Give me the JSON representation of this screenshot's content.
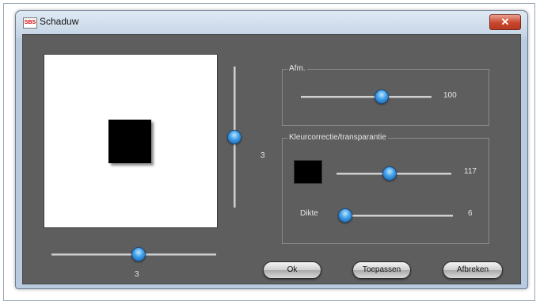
{
  "window": {
    "title": "Schaduw",
    "app_icon_text": "SBS",
    "close_glyph": "✕"
  },
  "preview": {
    "horizontal_offset": {
      "value": 3,
      "fraction": 0.53
    },
    "vertical_offset": {
      "value": 3,
      "fraction": 0.5
    }
  },
  "group_afm": {
    "title": "Afm.",
    "slider": {
      "value": 100,
      "fraction": 0.62
    }
  },
  "group_color": {
    "title": "Kleurcorrectie/transparantie",
    "swatch_color": "#000000",
    "opacity_slider": {
      "value": 117,
      "fraction": 0.46
    },
    "thickness_label": "Dikte",
    "thickness_slider": {
      "value": 6,
      "fraction": 0.06
    }
  },
  "buttons": {
    "ok": "Ok",
    "apply": "Toepassen",
    "cancel": "Afbreken"
  },
  "colors": {
    "accent_thumb": "#3d9ee8",
    "client_bg": "#5e5e5e"
  }
}
